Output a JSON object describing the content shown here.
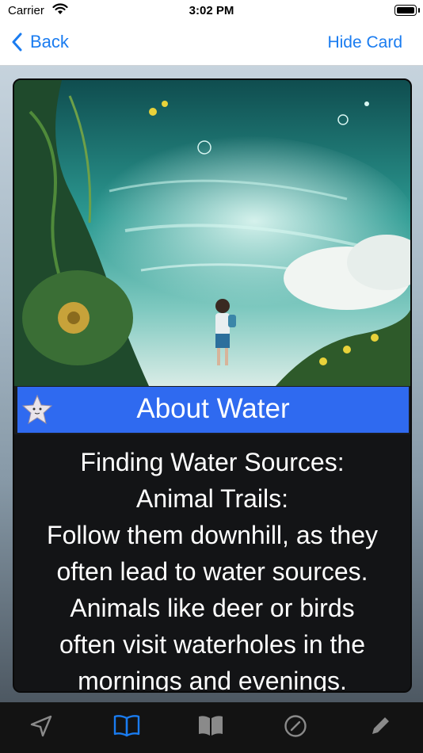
{
  "status_bar": {
    "carrier": "Carrier",
    "time": "3:02 PM"
  },
  "nav": {
    "back_label": "Back",
    "hide_card_label": "Hide Card"
  },
  "card": {
    "title": "About Water",
    "lines": [
      "Finding Water Sources:",
      "Animal Trails:",
      "Follow them downhill, as they",
      "often lead to water sources.",
      "Animals like deer or birds",
      "often visit waterholes in the",
      "mornings and evenings."
    ]
  },
  "tab_bar": {
    "tabs": [
      {
        "icon": "navigation-arrow-icon",
        "selected": false
      },
      {
        "icon": "book-open-icon",
        "selected": true
      },
      {
        "icon": "book-filled-icon",
        "selected": false
      },
      {
        "icon": "compass-icon",
        "selected": false
      },
      {
        "icon": "pencil-icon",
        "selected": false
      }
    ]
  },
  "colors": {
    "accent": "#1a7cf0",
    "title_band": "#2f6af0",
    "tab_selected": "#1a7cf0",
    "tab_unselected": "#8a8a8a"
  }
}
